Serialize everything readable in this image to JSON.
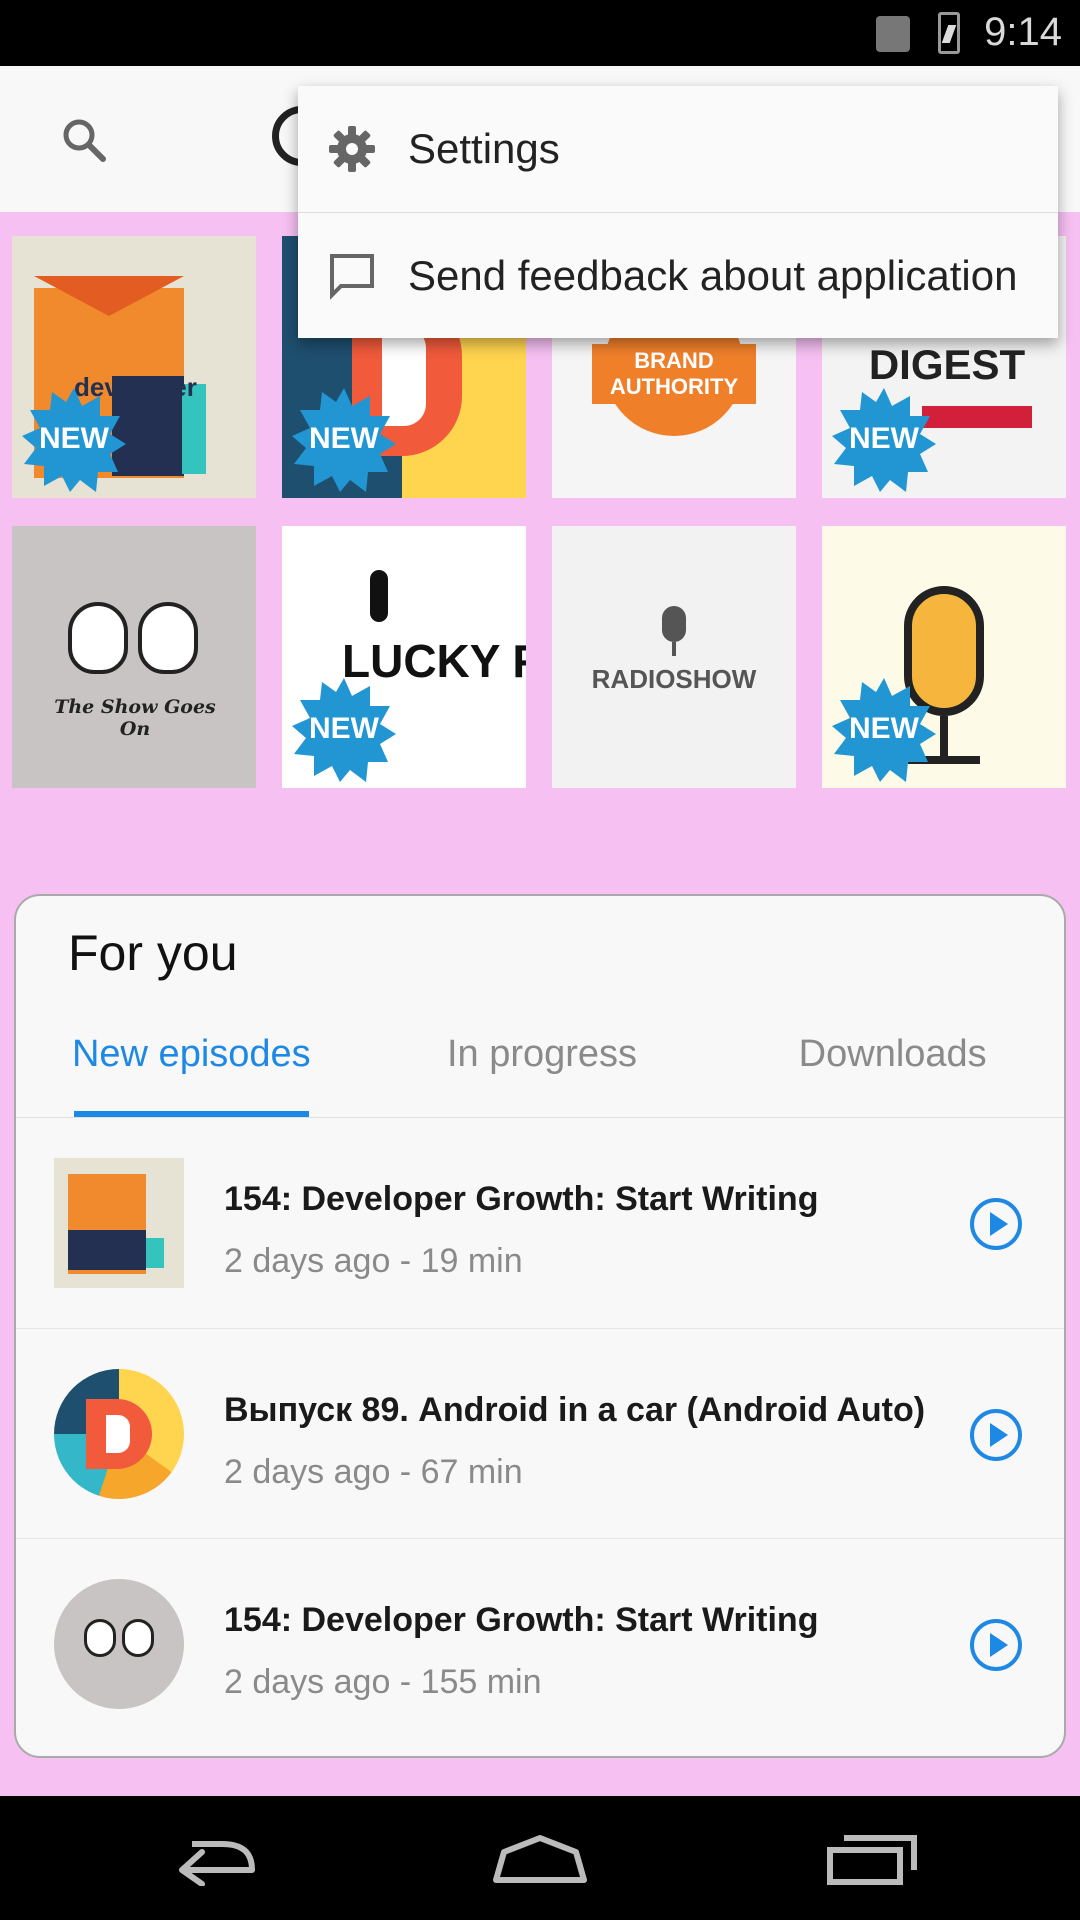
{
  "status_bar": {
    "time": "9:14"
  },
  "menu": {
    "items": [
      {
        "label": "Settings",
        "icon": "gear-icon"
      },
      {
        "label": "Send feedback about application",
        "icon": "feedback-icon"
      }
    ]
  },
  "grid": {
    "badge_text": "NEW",
    "tiles": [
      {
        "name": "Developer Tea",
        "is_new": true,
        "art_text": "developer"
      },
      {
        "name": "1D",
        "is_new": true,
        "art_text": ""
      },
      {
        "name": "Brand Authority",
        "is_new": false,
        "art_text": "BRAND AUTHORITY"
      },
      {
        "name": "Podcast Digest",
        "is_new": true,
        "art_text": "PODCAST DIGEST"
      },
      {
        "name": "The Show Goes On",
        "is_new": false,
        "art_text": "The Show Goes On"
      },
      {
        "name": "The Lucky Few",
        "is_new": true,
        "art_text": "LUCKY FEW"
      },
      {
        "name": "Radioshow",
        "is_new": false,
        "art_text": "RADIOSHOW"
      },
      {
        "name": "Mic Podcast",
        "is_new": true,
        "art_text": ""
      }
    ]
  },
  "for_you": {
    "title": "For you",
    "tabs": [
      "New episodes",
      "In progress",
      "Downloads"
    ],
    "active_tab": 0,
    "episodes": [
      {
        "title": "154: Developer Growth: Start Writing",
        "meta": "2 days ago - 19 min"
      },
      {
        "title": "Выпуск 89. Android in a car (Android Auto)",
        "meta": "2 days ago - 67 min"
      },
      {
        "title": "154: Developer Growth: Start Writing",
        "meta": "2 days ago - 155 min"
      }
    ]
  },
  "colors": {
    "accent": "#1e88e5",
    "badge": "#2196d3",
    "highlight": "#f6c0f3"
  }
}
